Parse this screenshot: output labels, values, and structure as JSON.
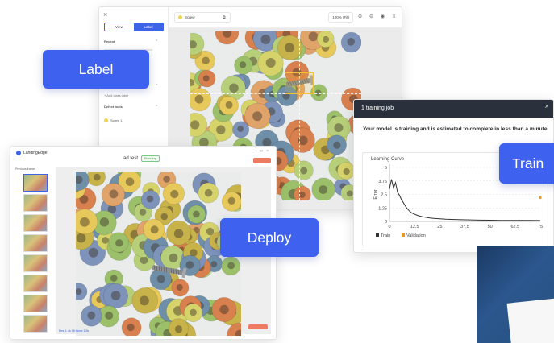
{
  "pills": {
    "label": "Label",
    "deploy": "Deploy",
    "train": "Train"
  },
  "label_window": {
    "close": "×",
    "view_mode": "View",
    "label_mode": "Label",
    "section_1": "Recent",
    "section_2": "",
    "section_3": "Defect tools",
    "add_class": "+ Add class label",
    "class_name": "Screw 1",
    "image_name": "Screw",
    "zoom": "100% (Fit)",
    "chevron": "^"
  },
  "deploy_window": {
    "app_name": "LandingEdge",
    "title": "ad test",
    "status": "Running",
    "sidebar_header": "Previous frames",
    "result_text": "Res 1: ok 98 frame 1.5s"
  },
  "train_window": {
    "header": "1 training job",
    "message": "Your model is training and is estimated to complete in less than a minute.",
    "chart_title": "Learning Curve"
  },
  "chart_data": {
    "type": "line",
    "title": "Learning Curve",
    "ylabel": "Error",
    "xlabel": "",
    "xlim": [
      0,
      75
    ],
    "ylim": [
      0,
      5
    ],
    "x_ticks": [
      "0",
      "12.5",
      "25",
      "37.5",
      "50",
      "62.5",
      "75"
    ],
    "y_ticks": [
      "0",
      "1.25",
      "2.5",
      "3.75",
      "5"
    ],
    "grid": true,
    "legend_position": "bottom-left",
    "series": [
      {
        "name": "Train",
        "color": "#333333",
        "x": [
          0,
          1,
          2,
          3,
          4,
          5,
          6,
          7,
          8,
          9,
          10,
          11,
          12,
          14,
          16,
          18,
          20,
          22,
          25,
          28,
          32,
          36,
          40,
          45,
          50,
          55,
          60,
          65,
          70,
          75
        ],
        "y": [
          3.0,
          3.9,
          3.1,
          3.6,
          2.7,
          2.4,
          2.0,
          1.7,
          1.4,
          1.15,
          0.95,
          0.8,
          0.7,
          0.55,
          0.45,
          0.38,
          0.32,
          0.28,
          0.24,
          0.2,
          0.18,
          0.16,
          0.14,
          0.12,
          0.11,
          0.1,
          0.1,
          0.09,
          0.09,
          0.08
        ]
      },
      {
        "name": "Validation",
        "color": "#e8962b",
        "x": [
          75
        ],
        "y": [
          2.2
        ]
      }
    ]
  }
}
